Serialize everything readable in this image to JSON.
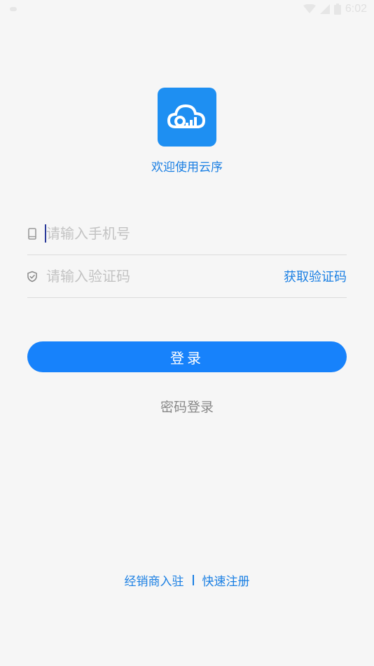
{
  "status_bar": {
    "time": "6:02",
    "icons": [
      "wifi-icon",
      "signal-icon",
      "battery-icon"
    ]
  },
  "app": {
    "logo_icon": "cloud-chart-icon",
    "welcome_text": "欢迎使用云序"
  },
  "form": {
    "phone_placeholder": "请输入手机号",
    "phone_value": "",
    "code_placeholder": "请输入验证码",
    "code_value": "",
    "get_code_label": "获取验证码"
  },
  "actions": {
    "login_label": "登录",
    "password_login_label": "密码登录"
  },
  "footer": {
    "dealer_join_label": "经销商入驻",
    "quick_register_label": "快速注册"
  },
  "colors": {
    "accent": "#1782fb",
    "link": "#1a7fe3",
    "background": "#f6f6f6"
  }
}
